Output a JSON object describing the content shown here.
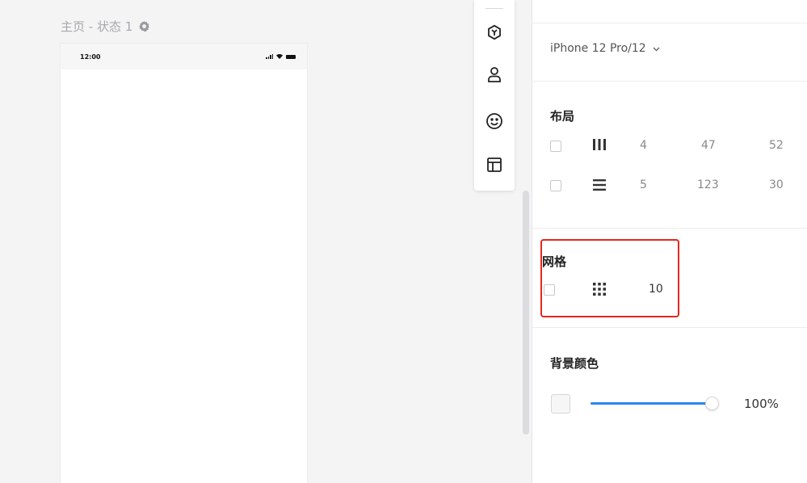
{
  "canvas": {
    "page_label": "主页 - 状态 1",
    "status_time": "12:00"
  },
  "toolbar": {
    "icons": [
      "cube-icon",
      "person-icon",
      "smiley-icon",
      "layout-icon"
    ]
  },
  "panel": {
    "device": "iPhone 12 Pro/12",
    "layout": {
      "title": "布局",
      "rows": [
        {
          "icon": "columns-icon",
          "count": "4",
          "width": "47",
          "gap": "52"
        },
        {
          "icon": "rows-icon",
          "count": "5",
          "width": "123",
          "gap": "30"
        }
      ]
    },
    "grid": {
      "title": "网格",
      "size": "10"
    },
    "background": {
      "title": "背景颜色",
      "opacity": "100%",
      "opacity_value": 1.0
    }
  },
  "colors": {
    "accent": "#2a86f0",
    "highlight": "#e8251f"
  }
}
